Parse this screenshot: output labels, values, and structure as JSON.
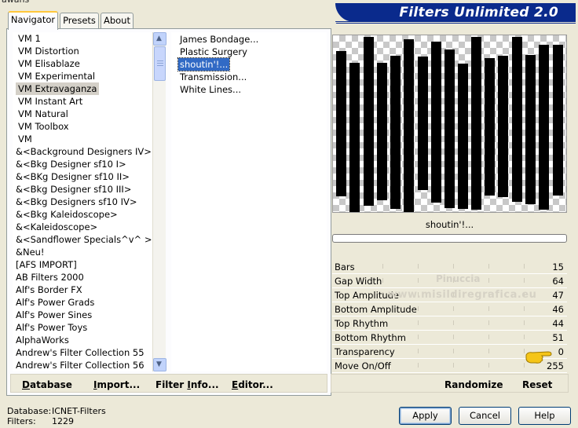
{
  "window": {
    "title_fragment": "awans"
  },
  "banner": {
    "title": "Filters Unlimited 2.0"
  },
  "tabs": [
    {
      "label": "Navigator",
      "active": true
    },
    {
      "label": "Presets",
      "active": false
    },
    {
      "label": "About",
      "active": false
    }
  ],
  "categories": [
    "VM 1",
    "VM Distortion",
    "VM Elisablaze",
    "VM Experimental",
    "VM Extravaganza",
    "VM Instant Art",
    "VM Natural",
    "VM Toolbox",
    "VM",
    "&<Background Designers IV>",
    "&<Bkg Designer sf10 I>",
    "&<BKg Designer sf10 II>",
    "&<Bkg Designer sf10 III>",
    "&<Bkg Designers sf10 IV>",
    "&<Bkg Kaleidoscope>",
    "&<Kaleidoscope>",
    "&<Sandflower Specials^v^ >",
    "&Neu!",
    "[AFS IMPORT]",
    "AB Filters 2000",
    "Alf's Border FX",
    "Alf's Power Grads",
    "Alf's Power Sines",
    "Alf's Power Toys",
    "AlphaWorks",
    "Andrew's Filter Collection 55",
    "Andrew's Filter Collection 56"
  ],
  "selected_category": "VM Extravaganza",
  "filters": [
    "James Bondage...",
    "Plastic Surgery",
    "shoutin'!...",
    "Transmission...",
    "White Lines..."
  ],
  "selected_filter": "shoutin'!...",
  "left_buttons": {
    "database": {
      "first": "D",
      "rest": "atabase"
    },
    "import": {
      "first": "I",
      "rest": "mport..."
    },
    "filter_info": {
      "pre": "Filter ",
      "first": "I",
      "rest": "nfo..."
    },
    "editor": {
      "first": "E",
      "rest": "ditor..."
    }
  },
  "preview": {
    "filter_name": "shoutin'!...",
    "bar_color": "#000000"
  },
  "parameters": [
    {
      "name": "Bars",
      "value": "15"
    },
    {
      "name": "Gap Width",
      "value": "64"
    },
    {
      "name": "Top Amplitude",
      "value": "47"
    },
    {
      "name": "Bottom Amplitude",
      "value": "46"
    },
    {
      "name": "Top Rhythm",
      "value": "44"
    },
    {
      "name": "Bottom Rhythm",
      "value": "51"
    },
    {
      "name": "Transparency",
      "value": "0"
    },
    {
      "name": "Move On/Off",
      "value": "255"
    }
  ],
  "watermark": {
    "line1": "Pinuccia",
    "line2": "www.misildiregrafica.eu"
  },
  "right_buttons": {
    "randomize": "Randomize",
    "reset": "Reset"
  },
  "status": {
    "database_label": "Database:",
    "database_value": "ICNET-Filters",
    "filters_label": "Filters:",
    "filters_value": "1229"
  },
  "dialog_buttons": {
    "apply": "Apply",
    "cancel": "Cancel",
    "help": "Help"
  },
  "colors": {
    "banner": "#0a2a8c",
    "selection": "#316ac5",
    "tab_highlight": "#ffc83c"
  }
}
